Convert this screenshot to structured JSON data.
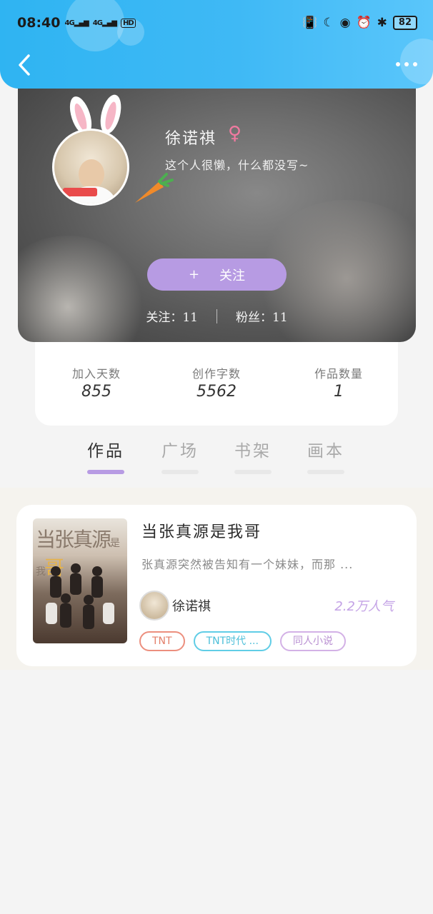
{
  "status_bar": {
    "time": "08:40",
    "signal1": "4G",
    "signal2": "4G",
    "hd": "HD",
    "battery": "82"
  },
  "profile": {
    "name": "徐诺祺",
    "gender_symbol": "♀",
    "bio": "这个人很懒，什么都没写~",
    "follow_button": "关注",
    "follow_plus": "+",
    "following": "关注：11",
    "fans": "粉丝：11"
  },
  "stats": [
    {
      "label": "加入天数",
      "value": "855"
    },
    {
      "label": "创作字数",
      "value": "5562"
    },
    {
      "label": "作品数量",
      "value": "1"
    }
  ],
  "tabs": [
    {
      "label": "作品",
      "active": true
    },
    {
      "label": "广场",
      "active": false
    },
    {
      "label": "书架",
      "active": false
    },
    {
      "label": "画本",
      "active": false
    }
  ],
  "book": {
    "cover_text_1": "当张",
    "cover_text_2": "真源",
    "cover_text_3": "是我",
    "cover_text_4": "哥",
    "title": "当张真源是我哥",
    "description": "张真源突然被告知有一个妹妹，而那 ...",
    "author": "徐诺祺",
    "popularity": "2.2万人气",
    "tags": [
      "TNT",
      "TNT时代 ...",
      "同人小说"
    ]
  },
  "colors": {
    "header": "#3fb9f5",
    "accent": "#b79be3",
    "gender": "#f07aa0"
  }
}
